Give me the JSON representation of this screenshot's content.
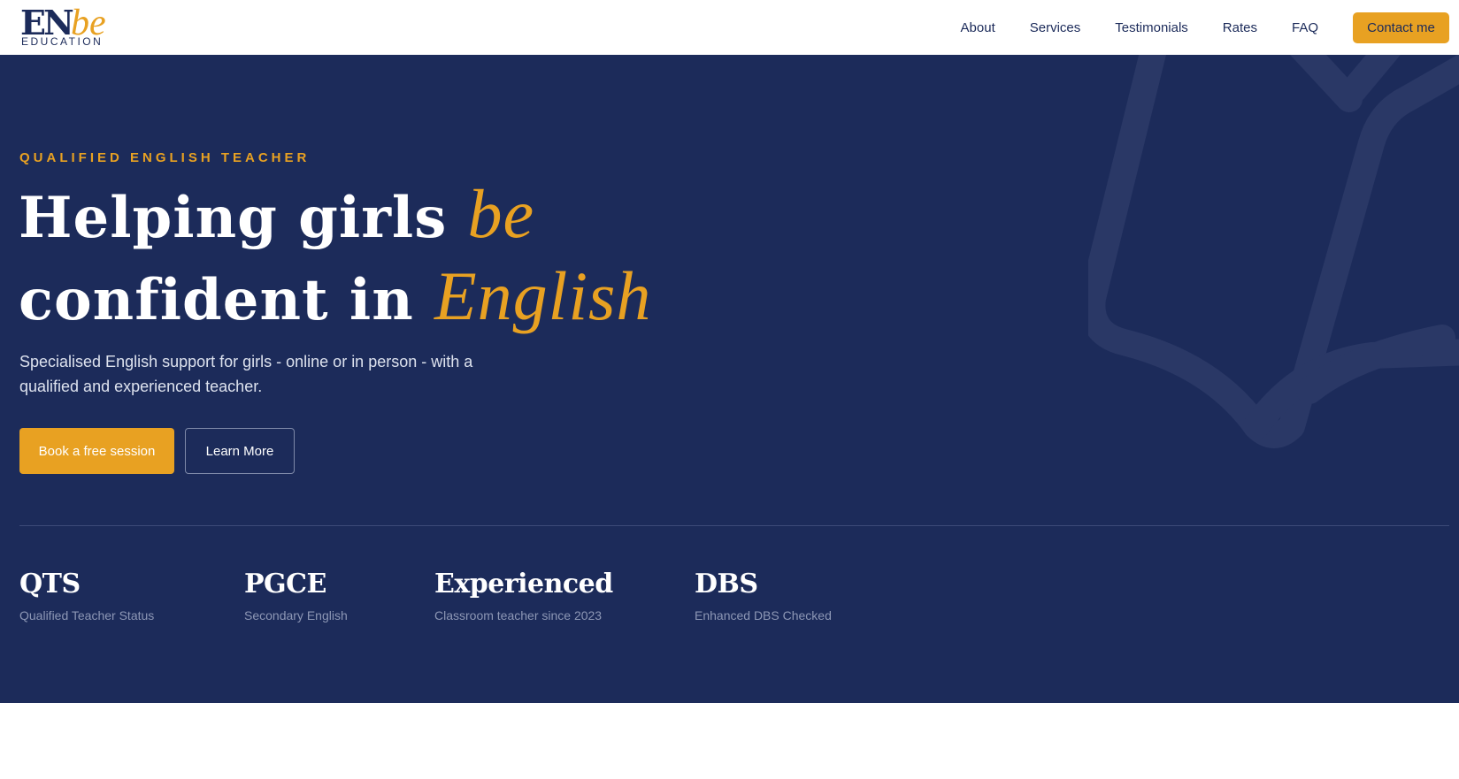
{
  "header": {
    "logo_main": "EN",
    "logo_accent": "be",
    "logo_sub": "EDUCATION",
    "nav": [
      "About",
      "Services",
      "Testimonials",
      "Rates",
      "FAQ"
    ],
    "contact_label": "Contact me"
  },
  "hero": {
    "eyebrow": "QUALIFIED ENGLISH TEACHER",
    "headline_1": "Helping girls ",
    "headline_1_accent": "be",
    "headline_2": "confident in ",
    "headline_2_accent": "English",
    "subtext": "Specialised English support for girls - online or in person - with a qualified and experienced teacher.",
    "primary_label": "Book a free session",
    "secondary_label": "Learn More",
    "stats": [
      {
        "title": "QTS",
        "desc": "Qualified Teacher Status"
      },
      {
        "title": "PGCE",
        "desc": "Secondary English"
      },
      {
        "title": "Experienced",
        "desc": "Classroom teacher since 2023"
      },
      {
        "title": "DBS",
        "desc": "Enhanced DBS Checked"
      }
    ]
  },
  "colors": {
    "navy": "#1c2b5a",
    "gold": "#e8a122",
    "white": "#ffffff"
  },
  "icons": {
    "hero_background": "open-book-icon"
  }
}
